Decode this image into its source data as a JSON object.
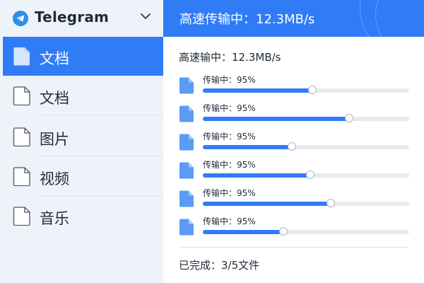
{
  "app": {
    "title": "Telegram"
  },
  "sidebar": {
    "items": [
      {
        "label": "文档",
        "active": true
      },
      {
        "label": "文档",
        "active": false
      },
      {
        "label": "图片",
        "active": false
      },
      {
        "label": "视频",
        "active": false
      },
      {
        "label": "音乐",
        "active": false
      }
    ]
  },
  "header": {
    "title": "高速传输中：12.3MB/s"
  },
  "main": {
    "speed": "高速输中：12.3MB/s",
    "transfers": [
      {
        "label": "传输中：95%",
        "progress": 0.53
      },
      {
        "label": "传输中：95%",
        "progress": 0.71
      },
      {
        "label": "传输中：95%",
        "progress": 0.43
      },
      {
        "label": "传输中：95%",
        "progress": 0.52
      },
      {
        "label": "传输中：95%",
        "progress": 0.62
      },
      {
        "label": "传输中：95%",
        "progress": 0.39
      }
    ],
    "completed": "已完成：3/5文件"
  },
  "colors": {
    "accent": "#2f7cf6",
    "sidebar_bg": "#eef3f9",
    "file_icon_blue": "#5b9bf5"
  },
  "icons": {
    "logo": "telegram-logo-icon",
    "chevron": "chevron-down-icon",
    "nav_file": "file-outline-icon",
    "transfer_file": "file-filled-icon"
  }
}
